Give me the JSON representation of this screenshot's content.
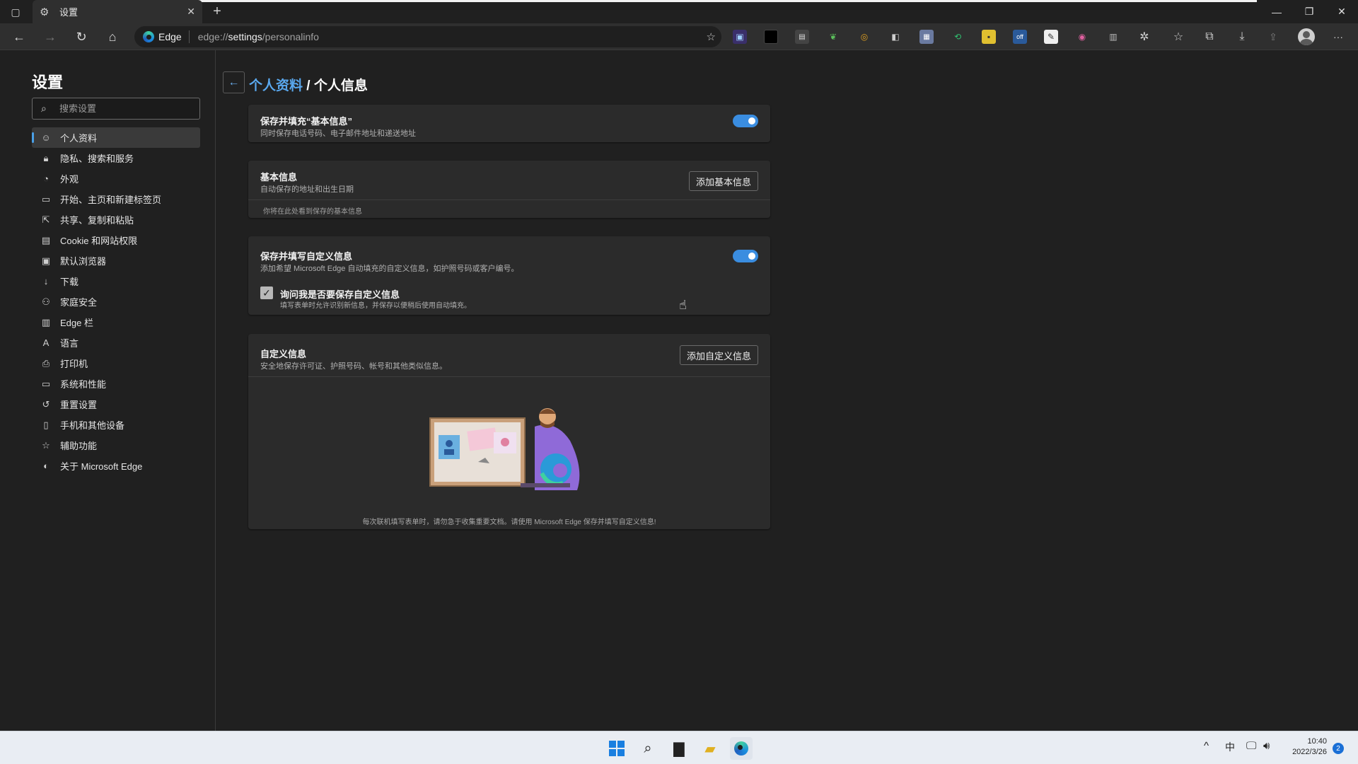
{
  "browser": {
    "tab_title": "设置",
    "brand": "Edge",
    "url_prefix": "edge://",
    "url_host": "settings",
    "url_path": "/personalinfo"
  },
  "sidebar": {
    "title": "设置",
    "search_placeholder": "搜索设置",
    "items": [
      {
        "label": "个人资料",
        "icon": "person-icon"
      },
      {
        "label": "隐私、搜索和服务",
        "icon": "lock-icon"
      },
      {
        "label": "外观",
        "icon": "appearance-icon"
      },
      {
        "label": "开始、主页和新建标签页",
        "icon": "home-page-icon"
      },
      {
        "label": "共享、复制和粘贴",
        "icon": "share-icon"
      },
      {
        "label": "Cookie 和网站权限",
        "icon": "site-permissions-icon"
      },
      {
        "label": "默认浏览器",
        "icon": "default-browser-icon"
      },
      {
        "label": "下载",
        "icon": "download-icon"
      },
      {
        "label": "家庭安全",
        "icon": "family-icon"
      },
      {
        "label": "Edge 栏",
        "icon": "edge-bar-icon"
      },
      {
        "label": "语言",
        "icon": "language-icon"
      },
      {
        "label": "打印机",
        "icon": "printer-icon"
      },
      {
        "label": "系统和性能",
        "icon": "system-icon"
      },
      {
        "label": "重置设置",
        "icon": "reset-icon"
      },
      {
        "label": "手机和其他设备",
        "icon": "phone-icon"
      },
      {
        "label": "辅助功能",
        "icon": "accessibility-icon"
      },
      {
        "label": "关于 Microsoft Edge",
        "icon": "edge-logo-icon"
      }
    ]
  },
  "page": {
    "breadcrumb_parent": "个人资料",
    "breadcrumb_sep": "/",
    "breadcrumb_current": "个人信息"
  },
  "cards": {
    "save_basic": {
      "title": "保存并填充“基本信息”",
      "subtitle": "同时保存电话号码、电子邮件地址和递送地址",
      "enabled": true
    },
    "basic_info": {
      "title": "基本信息",
      "subtitle": "自动保存的地址和出生日期",
      "button": "添加基本信息",
      "empty_text": "你将在此处看到保存的基本信息"
    },
    "save_custom": {
      "title": "保存并填写自定义信息",
      "subtitle": "添加希望 Microsoft Edge 自动填充的自定义信息，如护照号码或客户编号。",
      "enabled": true,
      "ask_label": "询问我是否要保存自定义信息",
      "ask_desc": "填写表单时允许识别新信息，并保存以便稍后使用自动填充。",
      "ask_checked": true
    },
    "custom_info": {
      "title": "自定义信息",
      "subtitle": "安全地保存许可证、护照号码、帐号和其他类似信息。",
      "button": "添加自定义信息",
      "footer": "每次联机填写表单时，请勿急于收集重要文档。请使用 Microsoft Edge 保存并填写自定义信息!"
    }
  },
  "taskbar": {
    "ime": "中",
    "time": "10:40",
    "date": "2022/3/26",
    "notifications": "2"
  },
  "colors": {
    "accent": "#3a8de0",
    "link": "#5aa8ee",
    "background": "#202020",
    "card": "#2b2b2b"
  }
}
